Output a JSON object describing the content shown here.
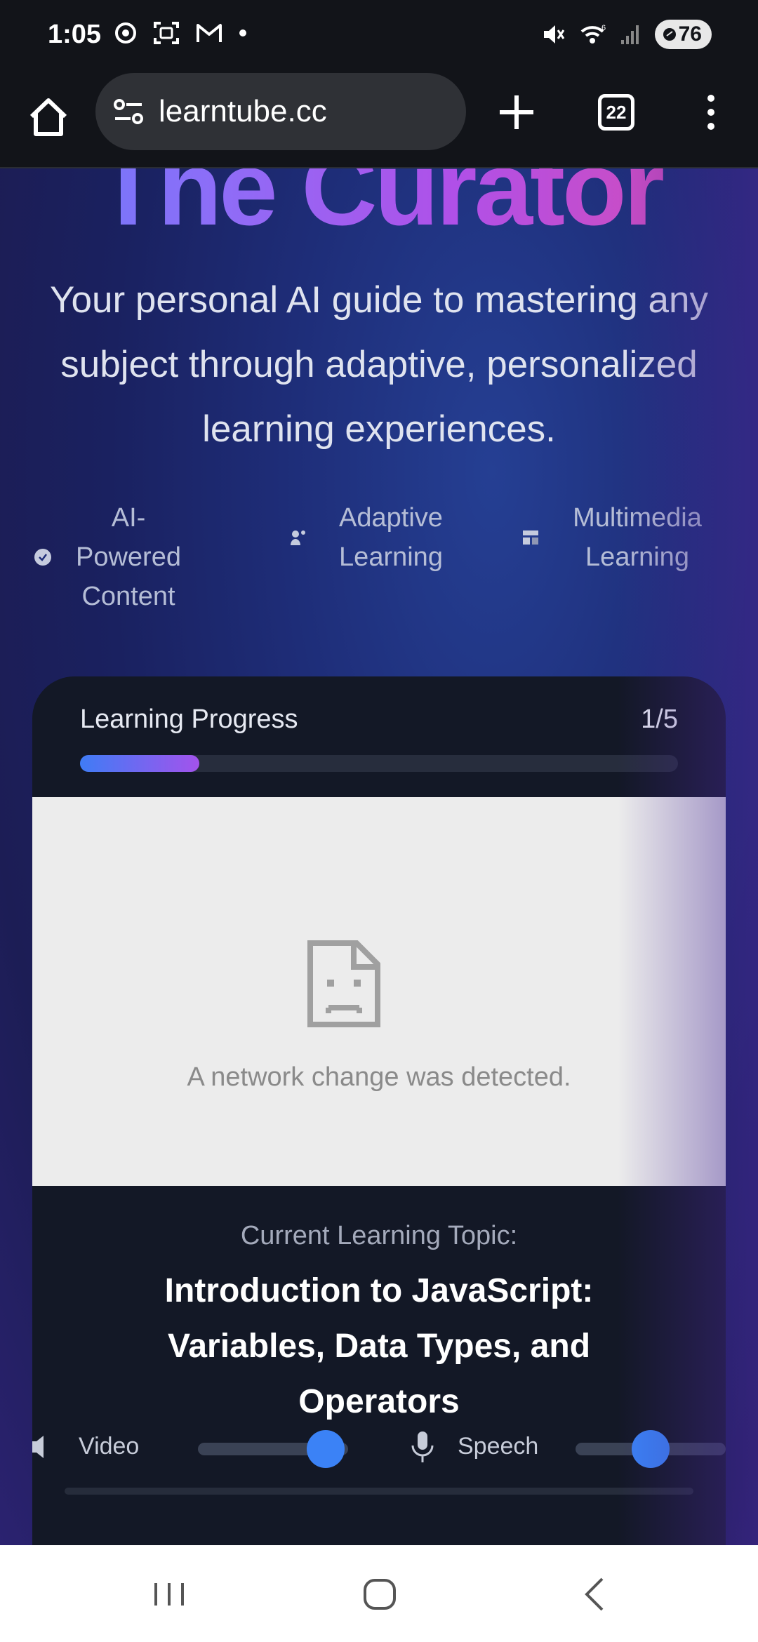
{
  "status_bar": {
    "time": "1:05",
    "battery": "76",
    "left_icons": [
      "chrome-icon",
      "screenshot-icon",
      "gmail-icon",
      "dot-icon"
    ],
    "right_icons": [
      "mute-icon",
      "wifi-icon",
      "signal-icon",
      "battery-icon"
    ]
  },
  "browser": {
    "url": "learntube.cc",
    "tab_count": "22"
  },
  "hero": {
    "title": "The Curator",
    "subtitle": "Your personal AI guide to mastering any subject through adaptive, personalized learning experiences."
  },
  "features": [
    {
      "line1": "AI-Powered",
      "line2": "Content",
      "icon": "check-circle-icon"
    },
    {
      "line1": "Adaptive",
      "line2": "Learning",
      "icon": "person-icon"
    },
    {
      "line1": "Multimedia",
      "line2": "Learning",
      "icon": "media-icon"
    }
  ],
  "progress": {
    "label": "Learning Progress",
    "count": "1/5",
    "fraction": 0.2
  },
  "video_error": {
    "message": "A network change was detected."
  },
  "topic": {
    "caption": "Current Learning Topic:",
    "title": "Introduction to JavaScript: Variables, Data Types, and Operators"
  },
  "controls": {
    "video_label": "Video",
    "video_level": 0.85,
    "speech_label": "Speech",
    "speech_level": 0.5
  },
  "colors": {
    "accent_blue": "#3b82f6",
    "accent_purple": "#a353ec",
    "card_bg": "#131826"
  }
}
